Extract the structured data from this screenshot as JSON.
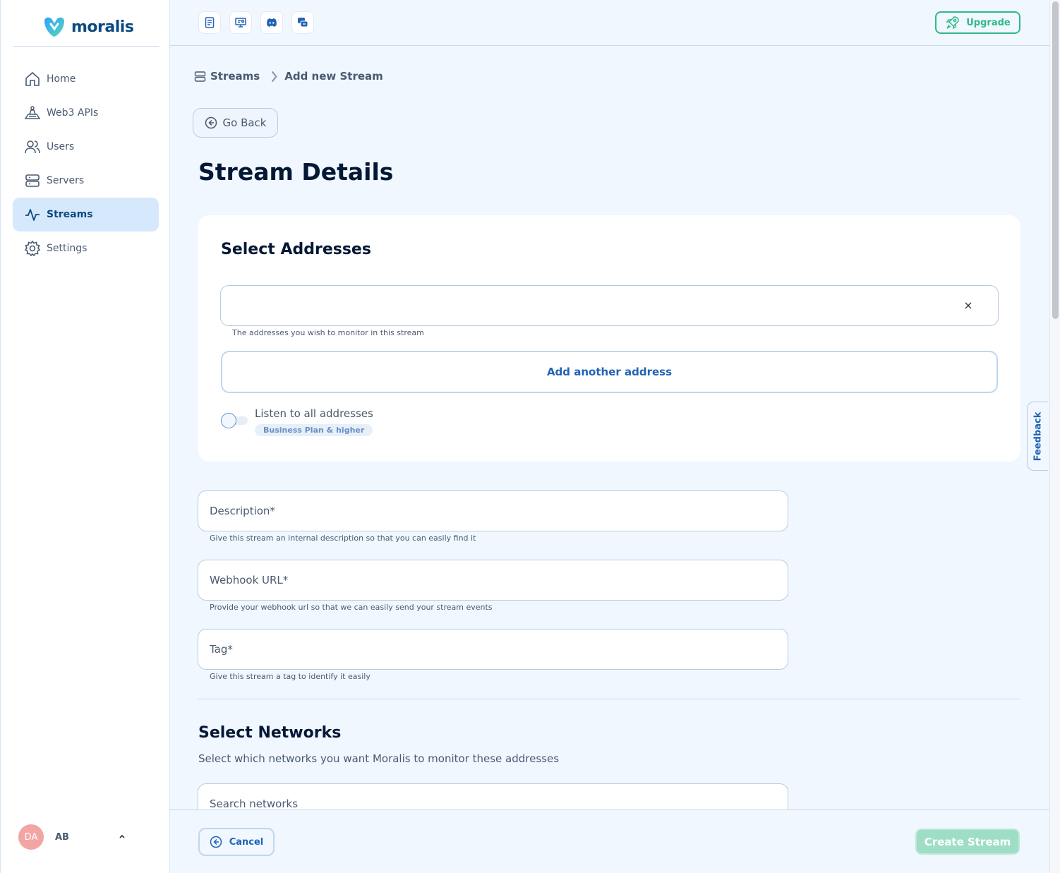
{
  "brand": {
    "name": "moralis",
    "colors": {
      "primary": "#2263b5",
      "accent_green": "#2fb989",
      "active_bg": "#d6e8fb"
    }
  },
  "sidebar": {
    "items": [
      {
        "label": "Home",
        "icon": "home-icon"
      },
      {
        "label": "Web3 APIs",
        "icon": "web3-apis-icon"
      },
      {
        "label": "Users",
        "icon": "users-icon"
      },
      {
        "label": "Servers",
        "icon": "servers-icon"
      },
      {
        "label": "Streams",
        "icon": "streams-icon",
        "active": true
      },
      {
        "label": "Settings",
        "icon": "gear-icon"
      }
    ],
    "user": {
      "initials": "DA",
      "name": "AB"
    }
  },
  "topbar": {
    "tools": [
      "docs-icon",
      "tutorial-icon",
      "discord-icon",
      "forum-icon"
    ],
    "upgrade_label": "Upgrade"
  },
  "breadcrumb": {
    "root": "Streams",
    "current": "Add new Stream"
  },
  "go_back_label": "Go Back",
  "page_title": "Stream Details",
  "addresses": {
    "title": "Select Addresses",
    "input_value": "",
    "clear_glyph": "×",
    "helper": "The addresses you wish to monitor in this stream",
    "add_label": "Add another address",
    "toggle_label": "Listen to all addresses",
    "toggle_on": false,
    "plan_badge": "Business Plan & higher"
  },
  "fields": {
    "description": {
      "placeholder": "Description*",
      "helper": "Give this stream an internal description so that you can easily find it"
    },
    "webhook": {
      "placeholder": "Webhook URL*",
      "helper": "Provide your webhook url so that we can easily send your stream events"
    },
    "tag": {
      "placeholder": "Tag*",
      "helper": "Give this stream a tag to identify it easily"
    }
  },
  "networks": {
    "title": "Select Networks",
    "subtitle": "Select which networks you want Moralis to monitor these addresses",
    "search_placeholder": "Search networks"
  },
  "footer": {
    "cancel_label": "Cancel",
    "create_label": "Create Stream"
  },
  "feedback_label": "Feedback"
}
